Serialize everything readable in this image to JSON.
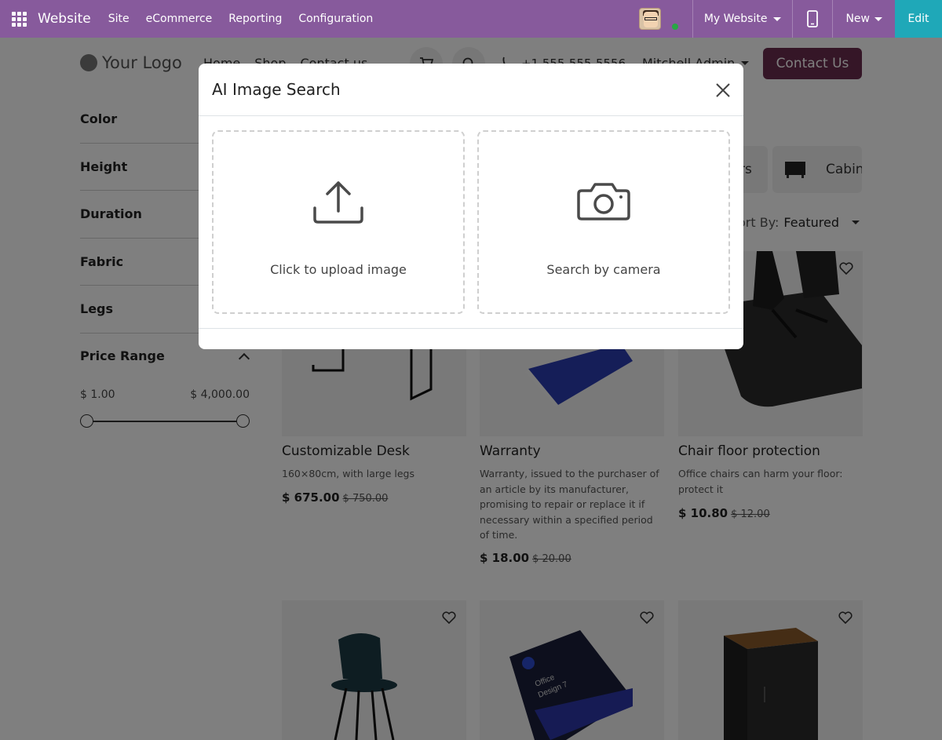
{
  "topbar": {
    "brand": "Website",
    "menus": [
      "Site",
      "eCommerce",
      "Reporting",
      "Configuration"
    ],
    "website_selector": "My Website",
    "new_label": "New",
    "edit_label": "Edit"
  },
  "site": {
    "logo_text": "Your Logo",
    "nav": [
      "Home",
      "Shop",
      "Contact us"
    ],
    "phone": "+1 555-555-5556",
    "user_menu": "Mitchell Admin",
    "contact_button": "Contact Us"
  },
  "sidebar": {
    "filters": [
      "Color",
      "Height",
      "Duration",
      "Fabric",
      "Legs"
    ],
    "price_range_label": "Price Range",
    "price_min": "$ 1.00",
    "price_max": "$ 4,000.00",
    "slider_min_fraction": 0,
    "slider_max_fraction": 1
  },
  "categories": {
    "pill1_fragment": "rs",
    "pill2_label": "Cabin"
  },
  "sort": {
    "prefix": "ort By:",
    "value": "Featured"
  },
  "products": [
    {
      "name": "Customizable Desk",
      "desc": "160×80cm, with large legs",
      "price": "$ 675.00",
      "old_price": "$ 750.00"
    },
    {
      "name": "Warranty",
      "desc": "Warranty, issued to the purchaser of an article by its manufacturer, promising to repair or replace it if necessary within a specified period of time.",
      "price": "$ 18.00",
      "old_price": "$ 20.00"
    },
    {
      "name": "Chair floor protection",
      "desc": "Office chairs can harm your floor: protect it",
      "price": "$ 10.80",
      "old_price": "$ 12.00"
    }
  ],
  "box_text": {
    "line1": "Office",
    "line2": "Design 7"
  },
  "modal": {
    "title": "AI Image Search",
    "upload_label": "Click to upload image",
    "camera_label": "Search by camera"
  },
  "colors": {
    "topbar": "#875a9c",
    "edit_button": "#1fa8b8",
    "contact_button": "#6b2d4e"
  }
}
